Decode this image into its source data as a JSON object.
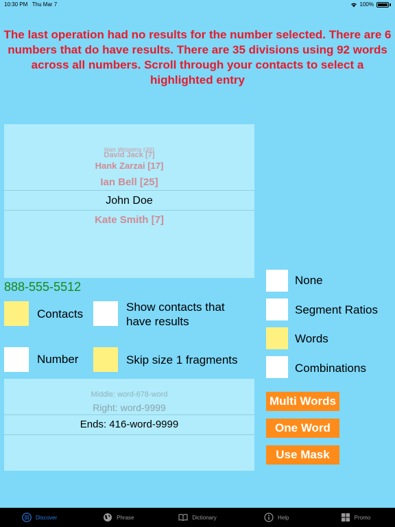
{
  "status_bar": {
    "time": "10:30 PM",
    "date": "Thu Mar 7",
    "battery": "100%"
  },
  "message": "The last operation had no results for the number selected. There are 6 numbers that do have results. There are 35 divisions using 92 words across all numbers. Scroll through your contacts to select a highlighted entry",
  "contacts_picker": {
    "rows": [
      "Nan Wiggins  [30]",
      "David Jack  [7]",
      "Hank Zarzai  [17]",
      "Ian Bell  [25]",
      "John Doe",
      "Kate Smith  [7]"
    ],
    "selected": "John Doe"
  },
  "phone_number": "888-555-5512",
  "source_options": {
    "contacts": {
      "label": "Contacts",
      "checked": true
    },
    "number": {
      "label": "Number",
      "checked": false
    },
    "show_results": {
      "label": "Show contacts that have results",
      "checked": false
    },
    "skip_size1": {
      "label": "Skip size 1 fragments",
      "checked": true
    }
  },
  "mode_options": {
    "none": {
      "label": "None",
      "checked": false
    },
    "segment_ratios": {
      "label": "Segment Ratios",
      "checked": false
    },
    "words": {
      "label": "Words",
      "checked": true
    },
    "combinations": {
      "label": "Combinations",
      "checked": false
    }
  },
  "matches_picker": {
    "rows": [
      "Middle: word-678-word",
      "Right: word-9999",
      "Ends: 416-word-9999"
    ],
    "selected": "Ends: 416-word-9999"
  },
  "buttons": {
    "multi_words": "Multi Words",
    "one_word": "One Word",
    "use_mask": "Use Mask"
  },
  "tabs": [
    {
      "label": "Discover",
      "icon": "discover-icon",
      "active": true
    },
    {
      "label": "Phrase",
      "icon": "globe-icon",
      "active": false
    },
    {
      "label": "Dictionary",
      "icon": "book-icon",
      "active": false
    },
    {
      "label": "Help",
      "icon": "info-icon",
      "active": false
    },
    {
      "label": "Promo",
      "icon": "grid-icon",
      "active": false
    }
  ],
  "colors": {
    "background": "#7ed8f8",
    "message": "#e51c2c",
    "checked": "#fff17f",
    "button": "#ff8c1a",
    "tab_active": "#2a7ae2"
  }
}
